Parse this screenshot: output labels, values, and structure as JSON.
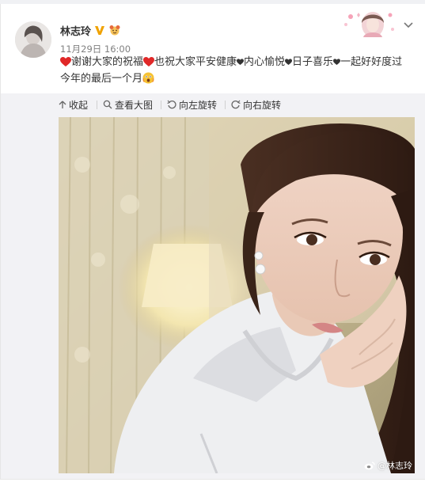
{
  "post": {
    "username": "林志玲",
    "timestamp": "11月29日 16:00",
    "text_parts": [
      "谢谢大家的祝福",
      "也祝大家平安健康",
      "内心愉悦",
      "日子喜乐",
      "一起好好度过",
      "今年的最后一个月"
    ]
  },
  "toolbar": {
    "collapse_label": "收起",
    "view_large_label": "查看大图",
    "rotate_left_label": "向左旋转",
    "rotate_right_label": "向右旋转"
  },
  "image": {
    "watermark": "@林志玲"
  },
  "icons": {
    "verified": "verified-v-icon",
    "member": "member-emoji-icon",
    "more": "chevron-down-icon",
    "heart": "red-heart-icon",
    "shocked": "shocked-face-icon",
    "weibo": "weibo-logo-icon"
  },
  "colors": {
    "accent_orange": "#f0a200",
    "heart_red": "#e02828",
    "toolbar_bg": "#f2f2f5"
  }
}
